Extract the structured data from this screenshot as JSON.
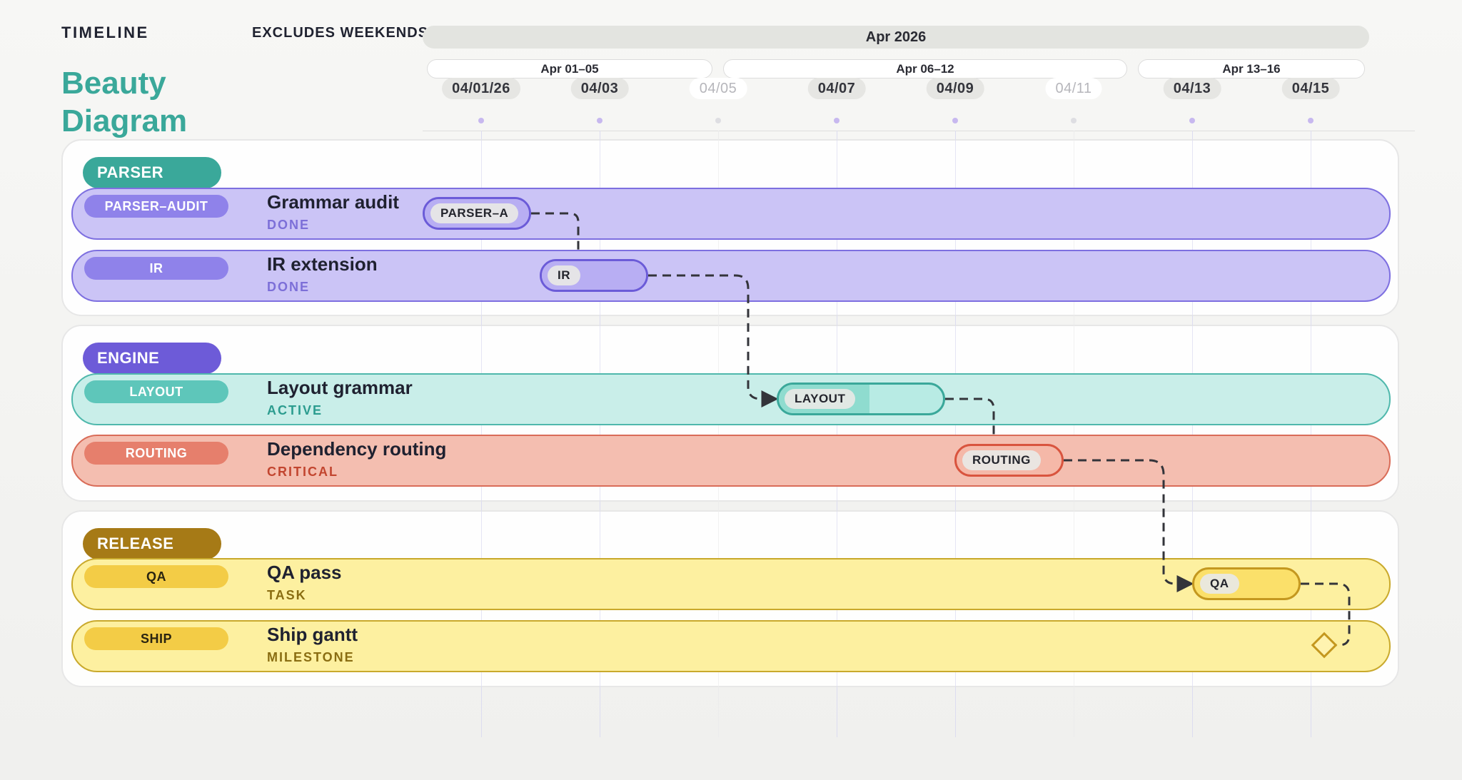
{
  "header": {
    "section_label": "TIMELINE",
    "weekend_note": "EXCLUDES WEEKENDS",
    "title": "Beauty Diagram"
  },
  "timeline": {
    "month": "Apr 2026",
    "weeks": [
      {
        "label": "Apr 01–05",
        "start": "04/01",
        "end": "04/05"
      },
      {
        "label": "Apr 06–12",
        "start": "04/06",
        "end": "04/12"
      },
      {
        "label": "Apr 13–16",
        "start": "04/13",
        "end": "04/16"
      }
    ],
    "date_ticks": [
      {
        "label": "04/01/26",
        "weekend": false
      },
      {
        "label": "04/03",
        "weekend": false
      },
      {
        "label": "04/05",
        "weekend": true
      },
      {
        "label": "04/07",
        "weekend": false
      },
      {
        "label": "04/09",
        "weekend": false
      },
      {
        "label": "04/11",
        "weekend": true
      },
      {
        "label": "04/13",
        "weekend": false
      },
      {
        "label": "04/15",
        "weekend": false
      }
    ]
  },
  "colors": {
    "parser": "#3aa89a",
    "engine": "#6d5bd8",
    "release": "#a67a16",
    "done_row": "#cbc4f6",
    "active_row": "#c9eee9",
    "critical_row": "#f4beb0",
    "task_row": "#fdf0a0"
  },
  "groups": [
    {
      "id": "parser",
      "label": "PARSER"
    },
    {
      "id": "engine",
      "label": "ENGINE"
    },
    {
      "id": "release",
      "label": "RELEASE"
    }
  ],
  "tasks": [
    {
      "id": "parser-audit",
      "group": "parser",
      "tag": "PARSER–AUDIT",
      "title": "Grammar audit",
      "status": "DONE",
      "bar_label": "PARSER–A",
      "start": "04/01",
      "end": "04/02",
      "progress": 1.0,
      "depends_on": null
    },
    {
      "id": "ir",
      "group": "parser",
      "tag": "IR",
      "title": "IR extension",
      "status": "DONE",
      "bar_label": "IR",
      "start": "04/02",
      "end": "04/03",
      "progress": 1.0,
      "depends_on": "parser-audit"
    },
    {
      "id": "layout",
      "group": "engine",
      "tag": "LAYOUT",
      "title": "Layout grammar",
      "status": "ACTIVE",
      "bar_label": "LAYOUT",
      "start": "04/06",
      "end": "04/08",
      "progress": 0.55,
      "depends_on": "ir"
    },
    {
      "id": "routing",
      "group": "engine",
      "tag": "ROUTING",
      "title": "Dependency routing",
      "status": "CRITICAL",
      "bar_label": "ROUTING",
      "start": "04/09",
      "end": "04/09",
      "progress": 0.0,
      "depends_on": "layout"
    },
    {
      "id": "qa",
      "group": "release",
      "tag": "QA",
      "title": "QA pass",
      "status": "TASK",
      "bar_label": "QA",
      "start": "04/13",
      "end": "04/14",
      "progress": 0.0,
      "depends_on": "routing"
    },
    {
      "id": "ship",
      "group": "release",
      "tag": "SHIP",
      "title": "Ship gantt",
      "status": "MILESTONE",
      "bar_label": "",
      "start": "04/15",
      "end": "04/15",
      "progress": 0.0,
      "depends_on": "qa"
    }
  ]
}
